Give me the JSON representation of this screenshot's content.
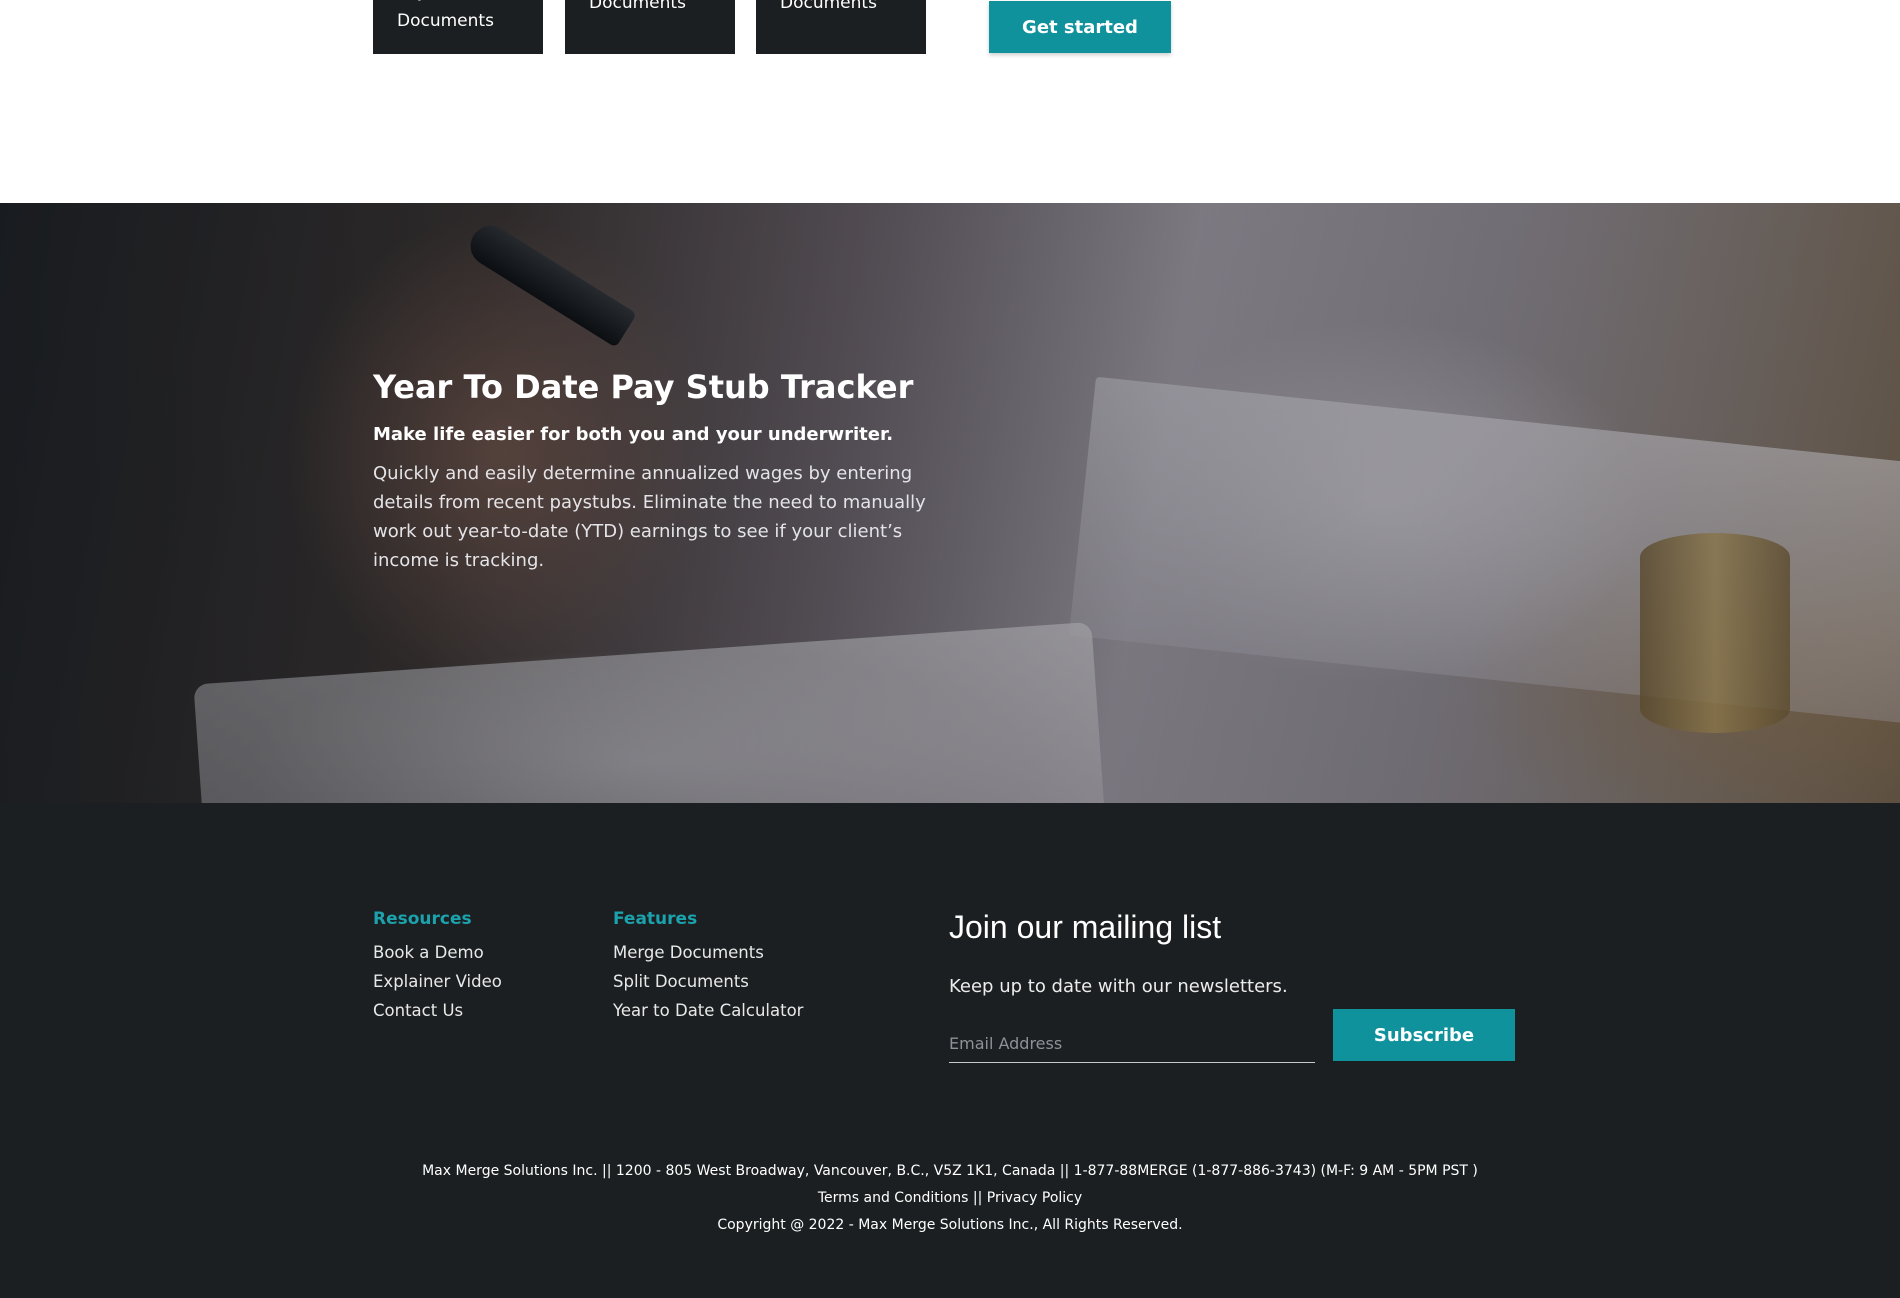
{
  "cards": [
    {
      "label": "Payment\nDocuments"
    },
    {
      "label": "Documents"
    },
    {
      "label": "Documents"
    }
  ],
  "cta": {
    "get_started": "Get started"
  },
  "hero": {
    "title": "Year To Date Pay Stub Tracker",
    "subtitle": "Make life easier for both you and your underwriter.",
    "body": "Quickly and easily determine annualized wages by entering details from recent paystubs. Eliminate the need to manually work out year-to-date (YTD) earnings to see if your client’s income is tracking."
  },
  "footer": {
    "resources": {
      "heading": "Resources",
      "links": [
        "Book a Demo",
        "Explainer Video",
        "Contact Us"
      ]
    },
    "features": {
      "heading": "Features",
      "links": [
        "Merge Documents",
        "Split Documents",
        "Year to Date Calculator"
      ]
    },
    "mailing": {
      "title": "Join our mailing list",
      "subtitle": "Keep up to date with our newsletters.",
      "email_placeholder": "Email Address",
      "subscribe_label": "Subscribe"
    },
    "address": "Max Merge Solutions Inc. || 1200 - 805 West Broadway, Vancouver, B.C., V5Z 1K1, Canada || 1-877-88MERGE (1-877-886-3743) (M-F: 9 AM - 5PM PST )",
    "terms": "Terms and Conditions",
    "legal_sep": "||",
    "privacy": "Privacy Policy",
    "copyright": "Copyright @ 2022 - Max Merge Solutions Inc., All Rights Reserved."
  },
  "colors": {
    "accent": "#10929d",
    "footer_bg": "#1b1f21",
    "heading_teal": "#1ba2ad"
  }
}
